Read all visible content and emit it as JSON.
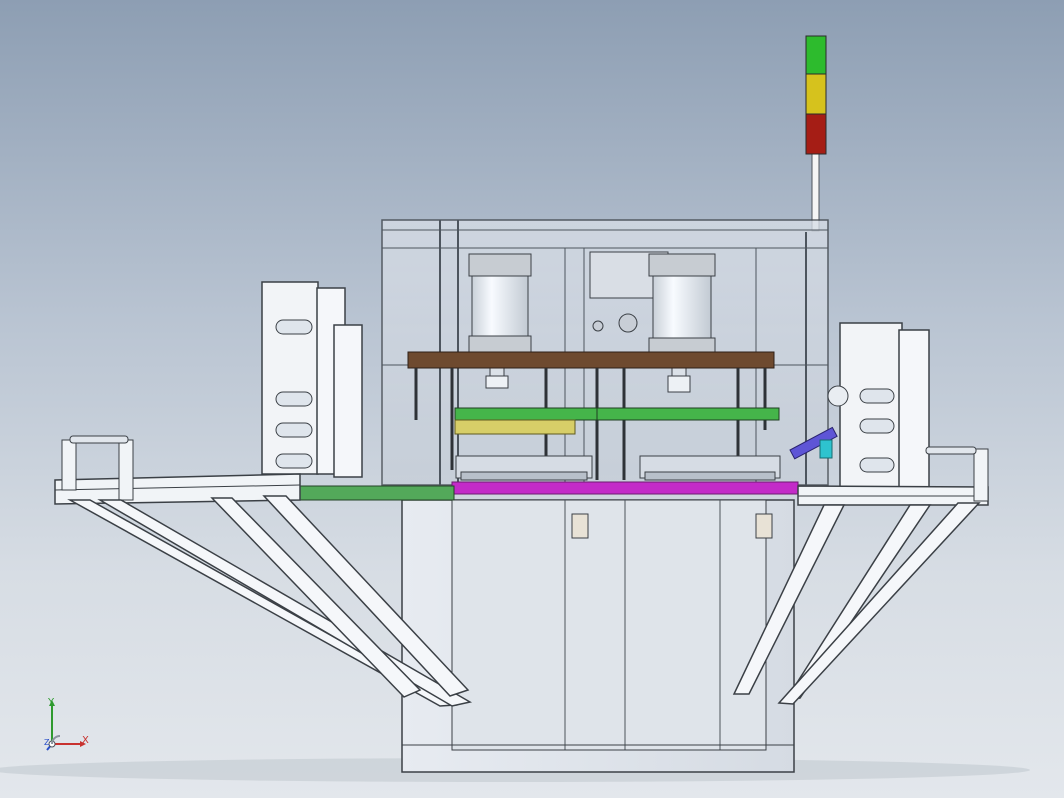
{
  "viewport": {
    "background_top": "#8d9eb3",
    "background_bottom": "#e3e7ec",
    "model_frame_color": "#f4f6f8",
    "edge_color": "#3b4046"
  },
  "model": {
    "components": [
      "stack-light",
      "machine-cabinet",
      "upper-guard-enclosure",
      "left-pneumatic-cylinder",
      "right-pneumatic-cylinder",
      "brown-mounting-plate",
      "green-pcb-fixture",
      "yellow-slide-rail",
      "magenta-base-plate",
      "left-side-frame",
      "right-side-frame",
      "left-work-table",
      "right-work-table",
      "left-support-struts",
      "right-support-struts",
      "green-conveyor-segments",
      "blue-guide-part"
    ],
    "colors": {
      "stack_light_green": "#2dbb2d",
      "stack_light_yellow": "#d6c21d",
      "stack_light_red": "#a51d15",
      "pcb_green": "#45b54a",
      "plate_brown": "#6e4a2f",
      "base_magenta": "#c32bc8",
      "rail_yellow": "#d7ce68",
      "guide_blue": "#5e55d6",
      "accent_cyan": "#2ec3cf"
    }
  },
  "triad": {
    "x_label": "X",
    "y_label": "Y",
    "z_label": "Z",
    "x_color": "#c8322f",
    "y_color": "#2f9a2f",
    "z_color": "#2a4fc9"
  }
}
